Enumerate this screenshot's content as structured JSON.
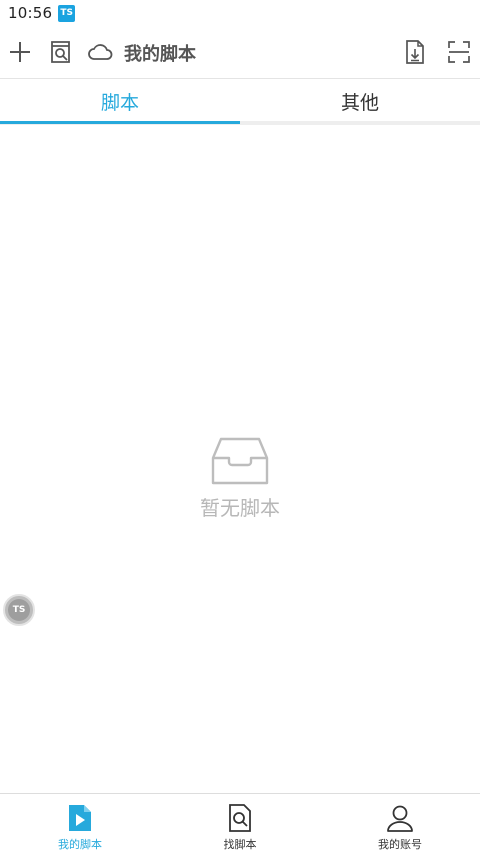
{
  "status_bar": {
    "time": "10:56",
    "app_badge": "TS"
  },
  "toolbar": {
    "title": "我的脚本",
    "icons": [
      "plus-icon",
      "search-document-icon",
      "cloud-icon",
      "import-file-icon",
      "scan-icon"
    ]
  },
  "tabs": [
    {
      "label": "脚本",
      "active": true
    },
    {
      "label": "其他",
      "active": false
    }
  ],
  "empty_state": {
    "icon": "inbox-icon",
    "message": "暂无脚本"
  },
  "floating_button": {
    "label": "TS"
  },
  "bottom_nav": {
    "items": [
      {
        "label": "我的脚本",
        "icon": "play-document-icon",
        "active": true
      },
      {
        "label": "找脚本",
        "icon": "search-document-icon",
        "active": false
      },
      {
        "label": "我的账号",
        "icon": "user-icon",
        "active": false
      }
    ]
  },
  "colors": {
    "accent": "#26a9dc",
    "badge": "#1aa3e0",
    "muted_text": "#b7b7b7",
    "icon_gray": "#555555"
  }
}
